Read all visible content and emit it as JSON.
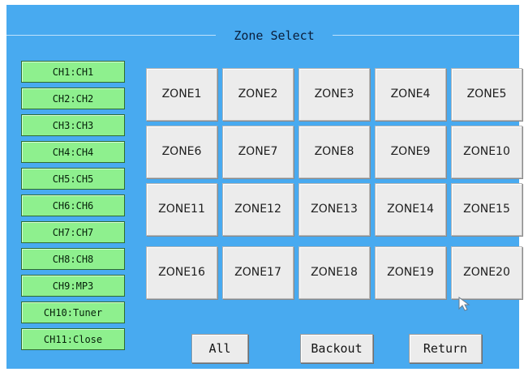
{
  "title": "Zone Select",
  "channels": [
    {
      "label": "CH1:CH1"
    },
    {
      "label": "CH2:CH2"
    },
    {
      "label": "CH3:CH3"
    },
    {
      "label": "CH4:CH4"
    },
    {
      "label": "CH5:CH5"
    },
    {
      "label": "CH6:CH6"
    },
    {
      "label": "CH7:CH7"
    },
    {
      "label": "CH8:CH8"
    },
    {
      "label": "CH9:MP3"
    },
    {
      "label": "CH10:Tuner"
    },
    {
      "label": "CH11:Close"
    }
  ],
  "zones": [
    {
      "label": "ZONE1"
    },
    {
      "label": "ZONE2"
    },
    {
      "label": "ZONE3"
    },
    {
      "label": "ZONE4"
    },
    {
      "label": "ZONE5"
    },
    {
      "label": "ZONE6"
    },
    {
      "label": "ZONE7"
    },
    {
      "label": "ZONE8"
    },
    {
      "label": "ZONE9"
    },
    {
      "label": "ZONE10"
    },
    {
      "label": "ZONE11"
    },
    {
      "label": "ZONE12"
    },
    {
      "label": "ZONE13"
    },
    {
      "label": "ZONE14"
    },
    {
      "label": "ZONE15"
    },
    {
      "label": "ZONE16"
    },
    {
      "label": "ZONE17"
    },
    {
      "label": "ZONE18"
    },
    {
      "label": "ZONE19"
    },
    {
      "label": "ZONE20"
    }
  ],
  "buttons": {
    "all": "All",
    "backout": "Backout",
    "return": "Return"
  },
  "colors": {
    "screen_background": "#48aaf0",
    "channel_button": "#8ef08e",
    "zone_button": "#ececec"
  },
  "icons": {
    "cursor": "pointer-cursor-icon"
  }
}
